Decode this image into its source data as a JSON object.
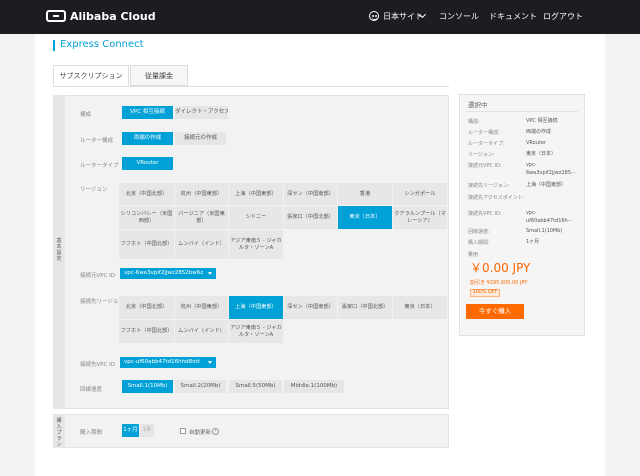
{
  "header": {
    "brand": "Alibaba Cloud",
    "language": "日本サイト",
    "console": "コンソール",
    "docs": "ドキュメント",
    "logout": "ログアウト"
  },
  "page": {
    "title": "Express Connect",
    "tabs": [
      "サブスクリプション",
      "従量課金"
    ]
  },
  "form": {
    "section_label": "基本設定",
    "instance_label": "構成",
    "instance_options": [
      "VPC 相互接続",
      "ダイレクト・アクセス"
    ],
    "router_config_label": "ルーター構成",
    "router_config_options": [
      "両端の作成",
      "接続元の作成"
    ],
    "router_type_label": "ルータータイプ",
    "router_type_options": [
      "VRouter"
    ],
    "region_label": "リージョン",
    "regions": [
      "北京（中国北部）",
      "杭州（中国東部）",
      "上海（中国東部）",
      "深セン（中国南部）",
      "香港",
      "シンガポール",
      "シリコンバレー（米国西部）",
      "バージニア（米国東部）",
      "シドニー",
      "張家口（中国北部）",
      "東京（日本）",
      "クアラルンプール（マレーシア）",
      "フフホト（中国北部）",
      "ムンバイ（インド）",
      "アジア東南５ - ジャカルタ・ゾーンA"
    ],
    "source_vpc_label": "接続元VPC ID",
    "source_vpc_value": "vpc-6we3vpif2jjwz2852bw6z",
    "dest_region_label": "接続先リージョン",
    "dest_regions": [
      "北京（中国北部）",
      "杭州（中国東部）",
      "上海（中国東部）",
      "深セン（中国南部）",
      "張家口（中国北部）",
      "東京（日本）",
      "フフホト（中国北部）",
      "ムンバイ（インド）",
      "アジア東南５ - ジャカルタ・ゾーンA"
    ],
    "dest_vpc_label": "接続先VPC ID",
    "dest_vpc_value": "vpc-uf60abb47td16hhd8ott",
    "bandwidth_label": "回線速度",
    "bandwidths": [
      "Small.1(10Mb)",
      "Small.2(20Mb)",
      "Small.5(50Mb)",
      "Middle.1(100Mb)"
    ]
  },
  "purchase": {
    "section_label": "購入プラン",
    "duration_label": "購入期間",
    "duration_options": [
      "1ヶ月",
      "1年"
    ],
    "auto_renew": "自動更新",
    "help": "?"
  },
  "summary": {
    "title": "選択中",
    "rows": [
      {
        "key": "構成:",
        "value": "VPC 相互接続"
      },
      {
        "key": "ルーター構成:",
        "value": "両端の作成"
      },
      {
        "key": "ルータータイプ:",
        "value": "VRouter"
      },
      {
        "key": "リージョン:",
        "value": "東京（日本）"
      },
      {
        "key": "接続元VPC ID:",
        "value": "vpc-6we3vpif2jjwz285···"
      },
      {
        "key": "接続先リージョン:",
        "value": "上海（中国東部）"
      },
      {
        "key": "接続先アクセスポイント:",
        "value": ""
      },
      {
        "key": "接続先VPC ID:",
        "value": "vpc-uf60abb47td16h···"
      },
      {
        "key": "回線速度:",
        "value": "Small.1(10Mb)"
      },
      {
        "key": "購入期間:",
        "value": "1ヶ月"
      }
    ],
    "price_label": "費用",
    "price": "￥0.00 JPY",
    "discount": "割引き ¥295,600.00 JPY",
    "badge": "100% OFF",
    "buy_button": "今すぐ購入"
  }
}
